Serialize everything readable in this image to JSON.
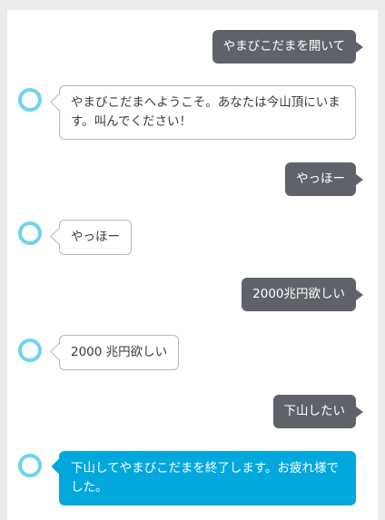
{
  "conversation": {
    "messages": [
      {
        "role": "user",
        "text": "やまびこだまを開いて"
      },
      {
        "role": "assistant",
        "text": "やまびこだまへようこそ。あなたは今山頂にいます。叫んでください！"
      },
      {
        "role": "user",
        "text": "やっほー"
      },
      {
        "role": "assistant",
        "text": "やっほー"
      },
      {
        "role": "user",
        "text": "2000兆円欲しい"
      },
      {
        "role": "assistant",
        "text": "2000 兆円欲しい"
      },
      {
        "role": "user",
        "text": "下山したい"
      },
      {
        "role": "assistant",
        "text": "下山してやまびこだまを終了します。お疲れ様でした。"
      }
    ]
  },
  "colors": {
    "user_bubble": "#5f6369",
    "assistant_bubble_border": "#b9b9b9",
    "assistant_final_bubble": "#00a8de",
    "avatar_ring": "#6fd3ef",
    "background": "#ebebeb"
  },
  "icons": {
    "assistant_avatar": "alexa-ring-icon"
  }
}
